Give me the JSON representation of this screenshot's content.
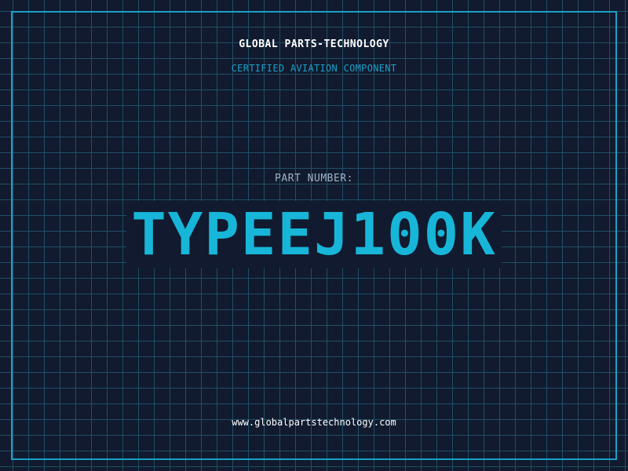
{
  "header": {
    "brand": "GLOBAL PARTS-TECHNOLOGY",
    "tagline": "CERTIFIED AVIATION COMPONENT"
  },
  "part": {
    "label": "PART NUMBER:",
    "number": "TYPEEJ100K"
  },
  "footer": {
    "website": "www.globalpartstechnology.com"
  },
  "colors": {
    "background": "#111a2e",
    "grid": "#1f4f66",
    "accent": "#1aa0c6",
    "part_number": "#17b6d9",
    "text": "#ffffff",
    "muted": "#9fb3c8"
  }
}
